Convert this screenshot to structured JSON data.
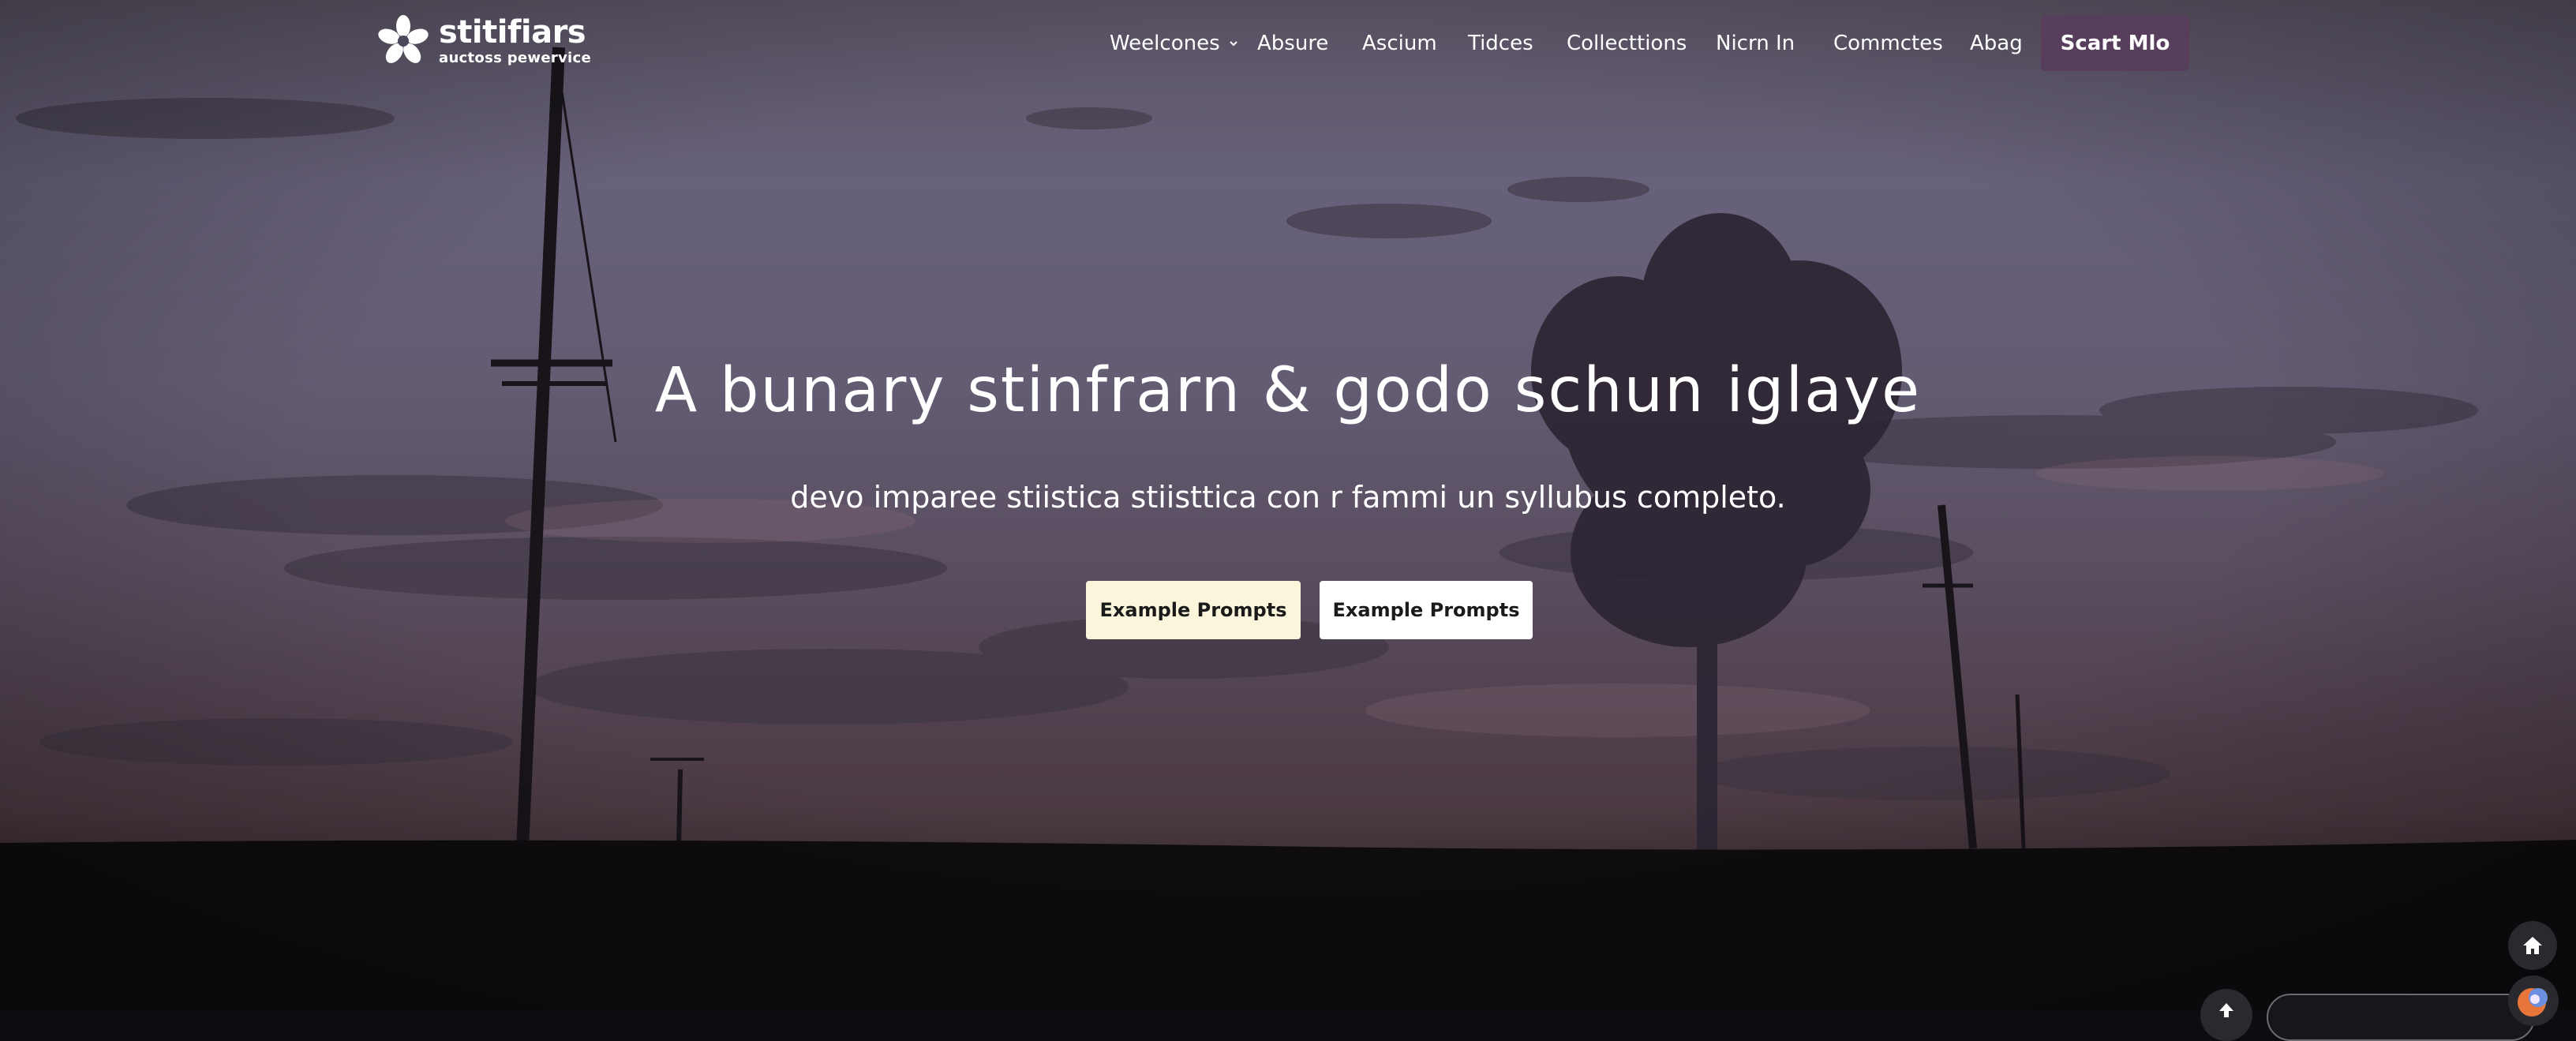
{
  "logo": {
    "name": "stitifiars",
    "tagline": "auctoss pewervice",
    "icon": "flower-logo-icon"
  },
  "nav": {
    "items": [
      {
        "label": "Weelcones",
        "has_dropdown": true
      },
      {
        "label": "Absure"
      },
      {
        "label": "Ascium"
      },
      {
        "label": "Tidces"
      },
      {
        "label": "Collecttions"
      },
      {
        "label": "Nicrn In"
      },
      {
        "label": "Commctes"
      },
      {
        "label": "Abag"
      }
    ],
    "cta_label": "Scart Mlo"
  },
  "hero": {
    "headline": "A bunary stinfrarn & godo schun iglaye",
    "subhead": "devo imparee stiistica  stiisttica con r fammi un syllubus completo.",
    "buttons": [
      {
        "label": "Example Prompts"
      },
      {
        "label": "Example Prompts"
      }
    ]
  },
  "widgets": {
    "home_icon": "home-icon",
    "up_icon": "arrow-up-icon"
  },
  "colors": {
    "cta_bg": "#573e5d",
    "btn1_bg": "#fbf5dc",
    "btn2_bg": "#ffffff"
  }
}
